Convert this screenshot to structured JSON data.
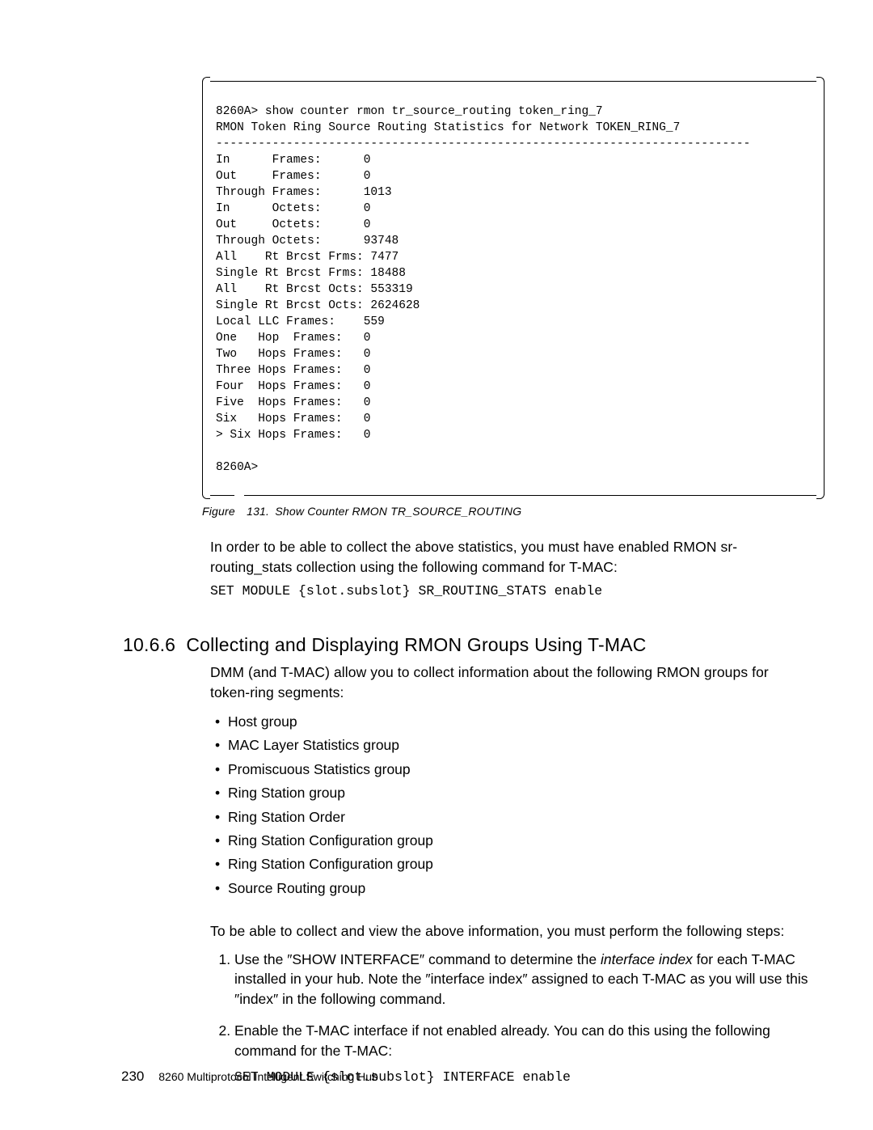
{
  "terminal": {
    "text": "8260A> show counter rmon tr_source_routing token_ring_7\nRMON Token Ring Source Routing Statistics for Network TOKEN_RING_7\n----------------------------------------------------------------------------\nIn      Frames:      0\nOut     Frames:      0\nThrough Frames:      1013\nIn      Octets:      0\nOut     Octets:      0\nThrough Octets:      93748\nAll    Rt Brcst Frms: 7477\nSingle Rt Brcst Frms: 18488\nAll    Rt Brcst Octs: 553319\nSingle Rt Brcst Octs: 2624628\nLocal LLC Frames:    559\nOne   Hop  Frames:   0\nTwo   Hops Frames:   0\nThree Hops Frames:   0\nFour  Hops Frames:   0\nFive  Hops Frames:   0\nSix   Hops Frames:   0\n> Six Hops Frames:   0\n\n8260A>"
  },
  "fig": {
    "label": "Figure 131. Show Counter RMON TR_SOURCE_ROUTING"
  },
  "intro": {
    "p1": "In order to be able to collect the above statistics, you must have enabled RMON sr-routing_stats collection using the following command for T-MAC:",
    "cmd1": "SET MODULE {slot.subslot} SR_ROUTING_STATS enable"
  },
  "section": {
    "num": "10.6.6",
    "title": "Collecting and Displaying RMON Groups Using T-MAC",
    "lead": "DMM (and T-MAC) allow you to collect information about the following RMON groups for token-ring segments:"
  },
  "bullets": [
    "Host group",
    "MAC Layer Statistics group",
    "Promiscuous Statistics group",
    "Ring Station group",
    "Ring Station Order",
    "Ring Station Configuration group",
    "Ring Station Configuration group",
    "Source Routing group"
  ],
  "steps_intro": "To be able to collect and view the above information, you must perform the following steps:",
  "steps": {
    "s1_pre": "Use the ",
    "s1_q1": "″SHOW INTERFACE″",
    "s1_mid1": " command to determine the ",
    "s1_ital": "interface index",
    "s1_mid2": " for each T-MAC installed in your hub.  Note the ",
    "s1_q2": "″interface index″",
    "s1_mid3": " assigned to each T-MAC as you will use this ",
    "s1_q3": "″index″",
    "s1_end": " in the following command.",
    "s2": "Enable the T-MAC interface if not enabled already.  You can do this using the following command for the T-MAC:",
    "s2_cmd": "SET MODULE {slot.subslot} INTERFACE enable"
  },
  "footer": {
    "page": "230",
    "title": "8260 Multiprotocol Intelligent Switching Hub"
  }
}
